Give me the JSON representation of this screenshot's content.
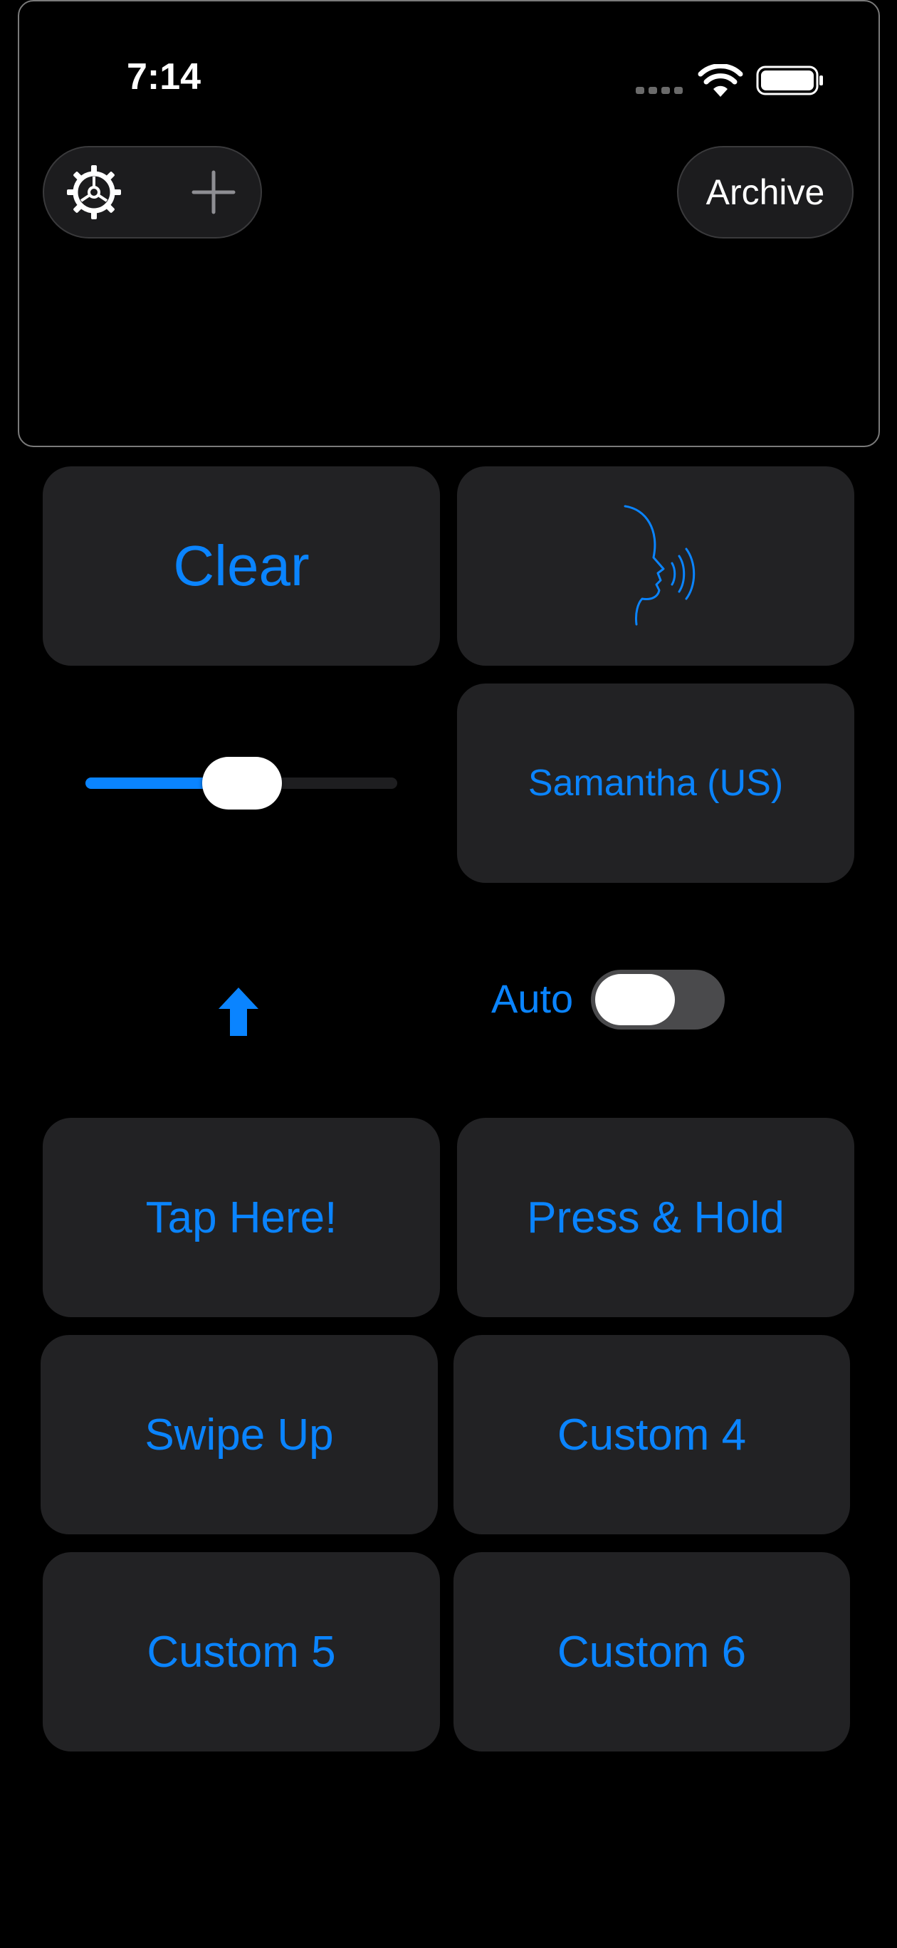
{
  "status_bar": {
    "time": "7:14",
    "icons": [
      "signal-dots-icon",
      "wifi-icon",
      "battery-icon"
    ]
  },
  "toolbar": {
    "settings_icon": "gear-icon",
    "add_icon": "plus-icon",
    "archive_label": "Archive"
  },
  "controls": {
    "clear_label": "Clear",
    "speak_icon": "speaking-head-icon",
    "voice_label": "Samantha (US)",
    "rate_slider_value": 0.5,
    "up_arrow_icon": "arrow-up-icon",
    "auto_label": "Auto",
    "auto_enabled": false
  },
  "phrase_buttons": [
    {
      "label": "Tap Here!"
    },
    {
      "label": "Press & Hold"
    },
    {
      "label": "Swipe Up"
    },
    {
      "label": "Custom 4"
    },
    {
      "label": "Custom 5"
    },
    {
      "label": "Custom 6"
    }
  ],
  "colors": {
    "accent": "#0a84ff",
    "tile_background": "#222224",
    "background": "#000000"
  }
}
